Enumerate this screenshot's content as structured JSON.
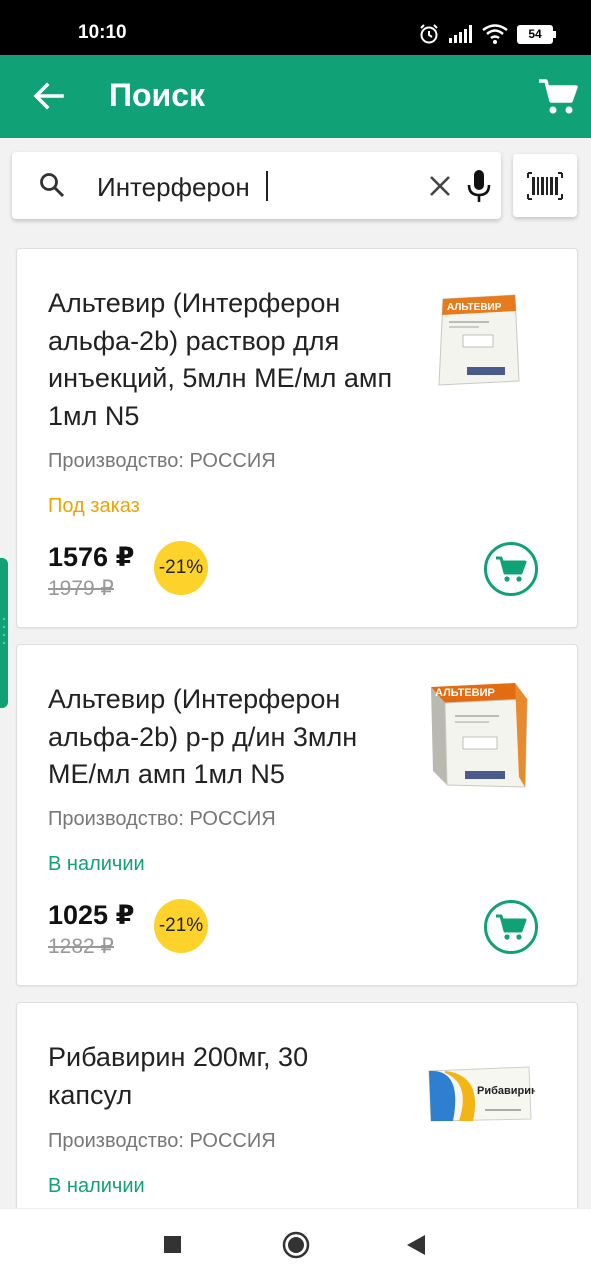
{
  "status_bar": {
    "time": "10:10",
    "battery": "54"
  },
  "header": {
    "title": "Поиск"
  },
  "search": {
    "value": "Интерферон",
    "placeholder": ""
  },
  "products": [
    {
      "title": "Альтевир (Интерферон альфа-2b) раствор для инъекций, 5млн МЕ/мл амп 1мл N5",
      "maker": "Производство: РОССИЯ",
      "availability": "Под заказ",
      "price": "1576 ₽",
      "old_price": "1979 ₽",
      "discount": "-21%",
      "image_brand": "АЛЬТЕВИР"
    },
    {
      "title": "Альтевир (Интерферон альфа-2b) р-р д/ин 3млн МЕ/мл амп 1мл N5",
      "maker": "Производство: РОССИЯ",
      "availability": "В наличии",
      "price": "1025 ₽",
      "old_price": "1282 ₽",
      "discount": "-21%",
      "image_brand": "АЛЬТЕВИР"
    },
    {
      "title": "Рибавирин 200мг, 30 капсул",
      "maker": "Производство: РОССИЯ",
      "availability": "В наличии",
      "image_brand": "Рибавирин"
    }
  ],
  "colors": {
    "brand": "#10a176",
    "order": "#f0a202",
    "discount": "#fdd32b"
  },
  "icons": {
    "back": "arrow-left-icon",
    "cart": "cart-icon",
    "search": "search-icon",
    "clear": "close-icon",
    "mic": "microphone-icon",
    "barcode": "barcode-icon",
    "nav": [
      "square-recents-icon",
      "circle-home-icon",
      "triangle-back-icon"
    ]
  }
}
